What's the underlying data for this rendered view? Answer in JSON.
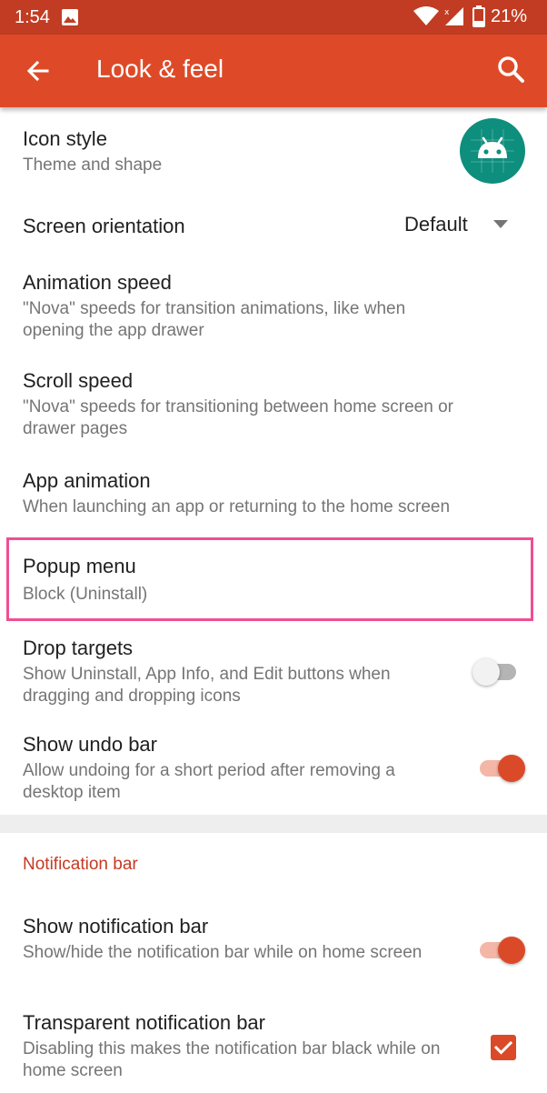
{
  "status_bar": {
    "time": "1:54",
    "battery": "21%"
  },
  "app_bar": {
    "title": "Look & feel"
  },
  "settings": [
    {
      "title": "Icon style",
      "summary": "Theme and shape"
    },
    {
      "title": "Screen orientation",
      "value": "Default"
    },
    {
      "title": "Animation speed",
      "summary": "\"Nova\" speeds for transition animations, like when opening the app drawer"
    },
    {
      "title": "Scroll speed",
      "summary": "\"Nova\" speeds for transitioning between home screen or drawer pages"
    },
    {
      "title": "App animation",
      "summary": "When launching an app or returning to the home screen"
    },
    {
      "title": "Popup menu",
      "summary": "Block (Uninstall)"
    },
    {
      "title": "Drop targets",
      "summary": "Show Uninstall, App Info, and Edit buttons when dragging and dropping icons",
      "enabled": false
    },
    {
      "title": "Show undo bar",
      "summary": "Allow undoing for a short period after removing a desktop item",
      "enabled": true
    }
  ],
  "notification_section": {
    "header": "Notification bar",
    "items": [
      {
        "title": "Show notification bar",
        "summary": "Show/hide the notification bar while on home screen",
        "enabled": true
      },
      {
        "title": "Transparent notification bar",
        "summary": "Disabling this makes the notification bar black while on home screen",
        "checked": true
      }
    ]
  },
  "colors": {
    "status_bar": "#c13c22",
    "app_bar": "#de4a28",
    "accent": "#db4a28",
    "highlight": "#ef4e92",
    "icon_preview_bg": "#0e8e7d"
  },
  "icons": {
    "back": "arrow-back-icon",
    "search": "search-icon",
    "icon_preview": "android-robot-icon",
    "dropdown": "triangle-down-icon"
  }
}
